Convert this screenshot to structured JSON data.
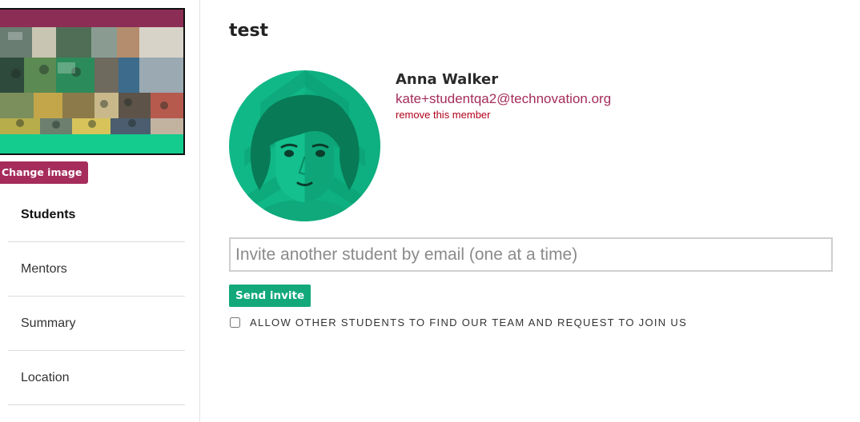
{
  "sidebar": {
    "change_image_label": "Change image",
    "nav": [
      {
        "label": "Students",
        "active": true
      },
      {
        "label": "Mentors",
        "active": false
      },
      {
        "label": "Summary",
        "active": false
      },
      {
        "label": "Location",
        "active": false
      }
    ]
  },
  "team": {
    "name": "test"
  },
  "member": {
    "name": "Anna Walker",
    "email": "kate+studentqa2@technovation.org",
    "remove_label": "remove this member",
    "avatar_icon": "female-student-avatar-icon"
  },
  "invite": {
    "placeholder": "Invite another student by email (one at a time)",
    "value": "",
    "send_label": "Send invite"
  },
  "join_requests": {
    "label": "Allow other students to find our team and request to join us",
    "checked": false
  },
  "colors": {
    "brand_magenta": "#a52c5b",
    "send_green": "#12a87a",
    "avatar_green": "#0fb88a",
    "remove_red": "#b3001b"
  }
}
